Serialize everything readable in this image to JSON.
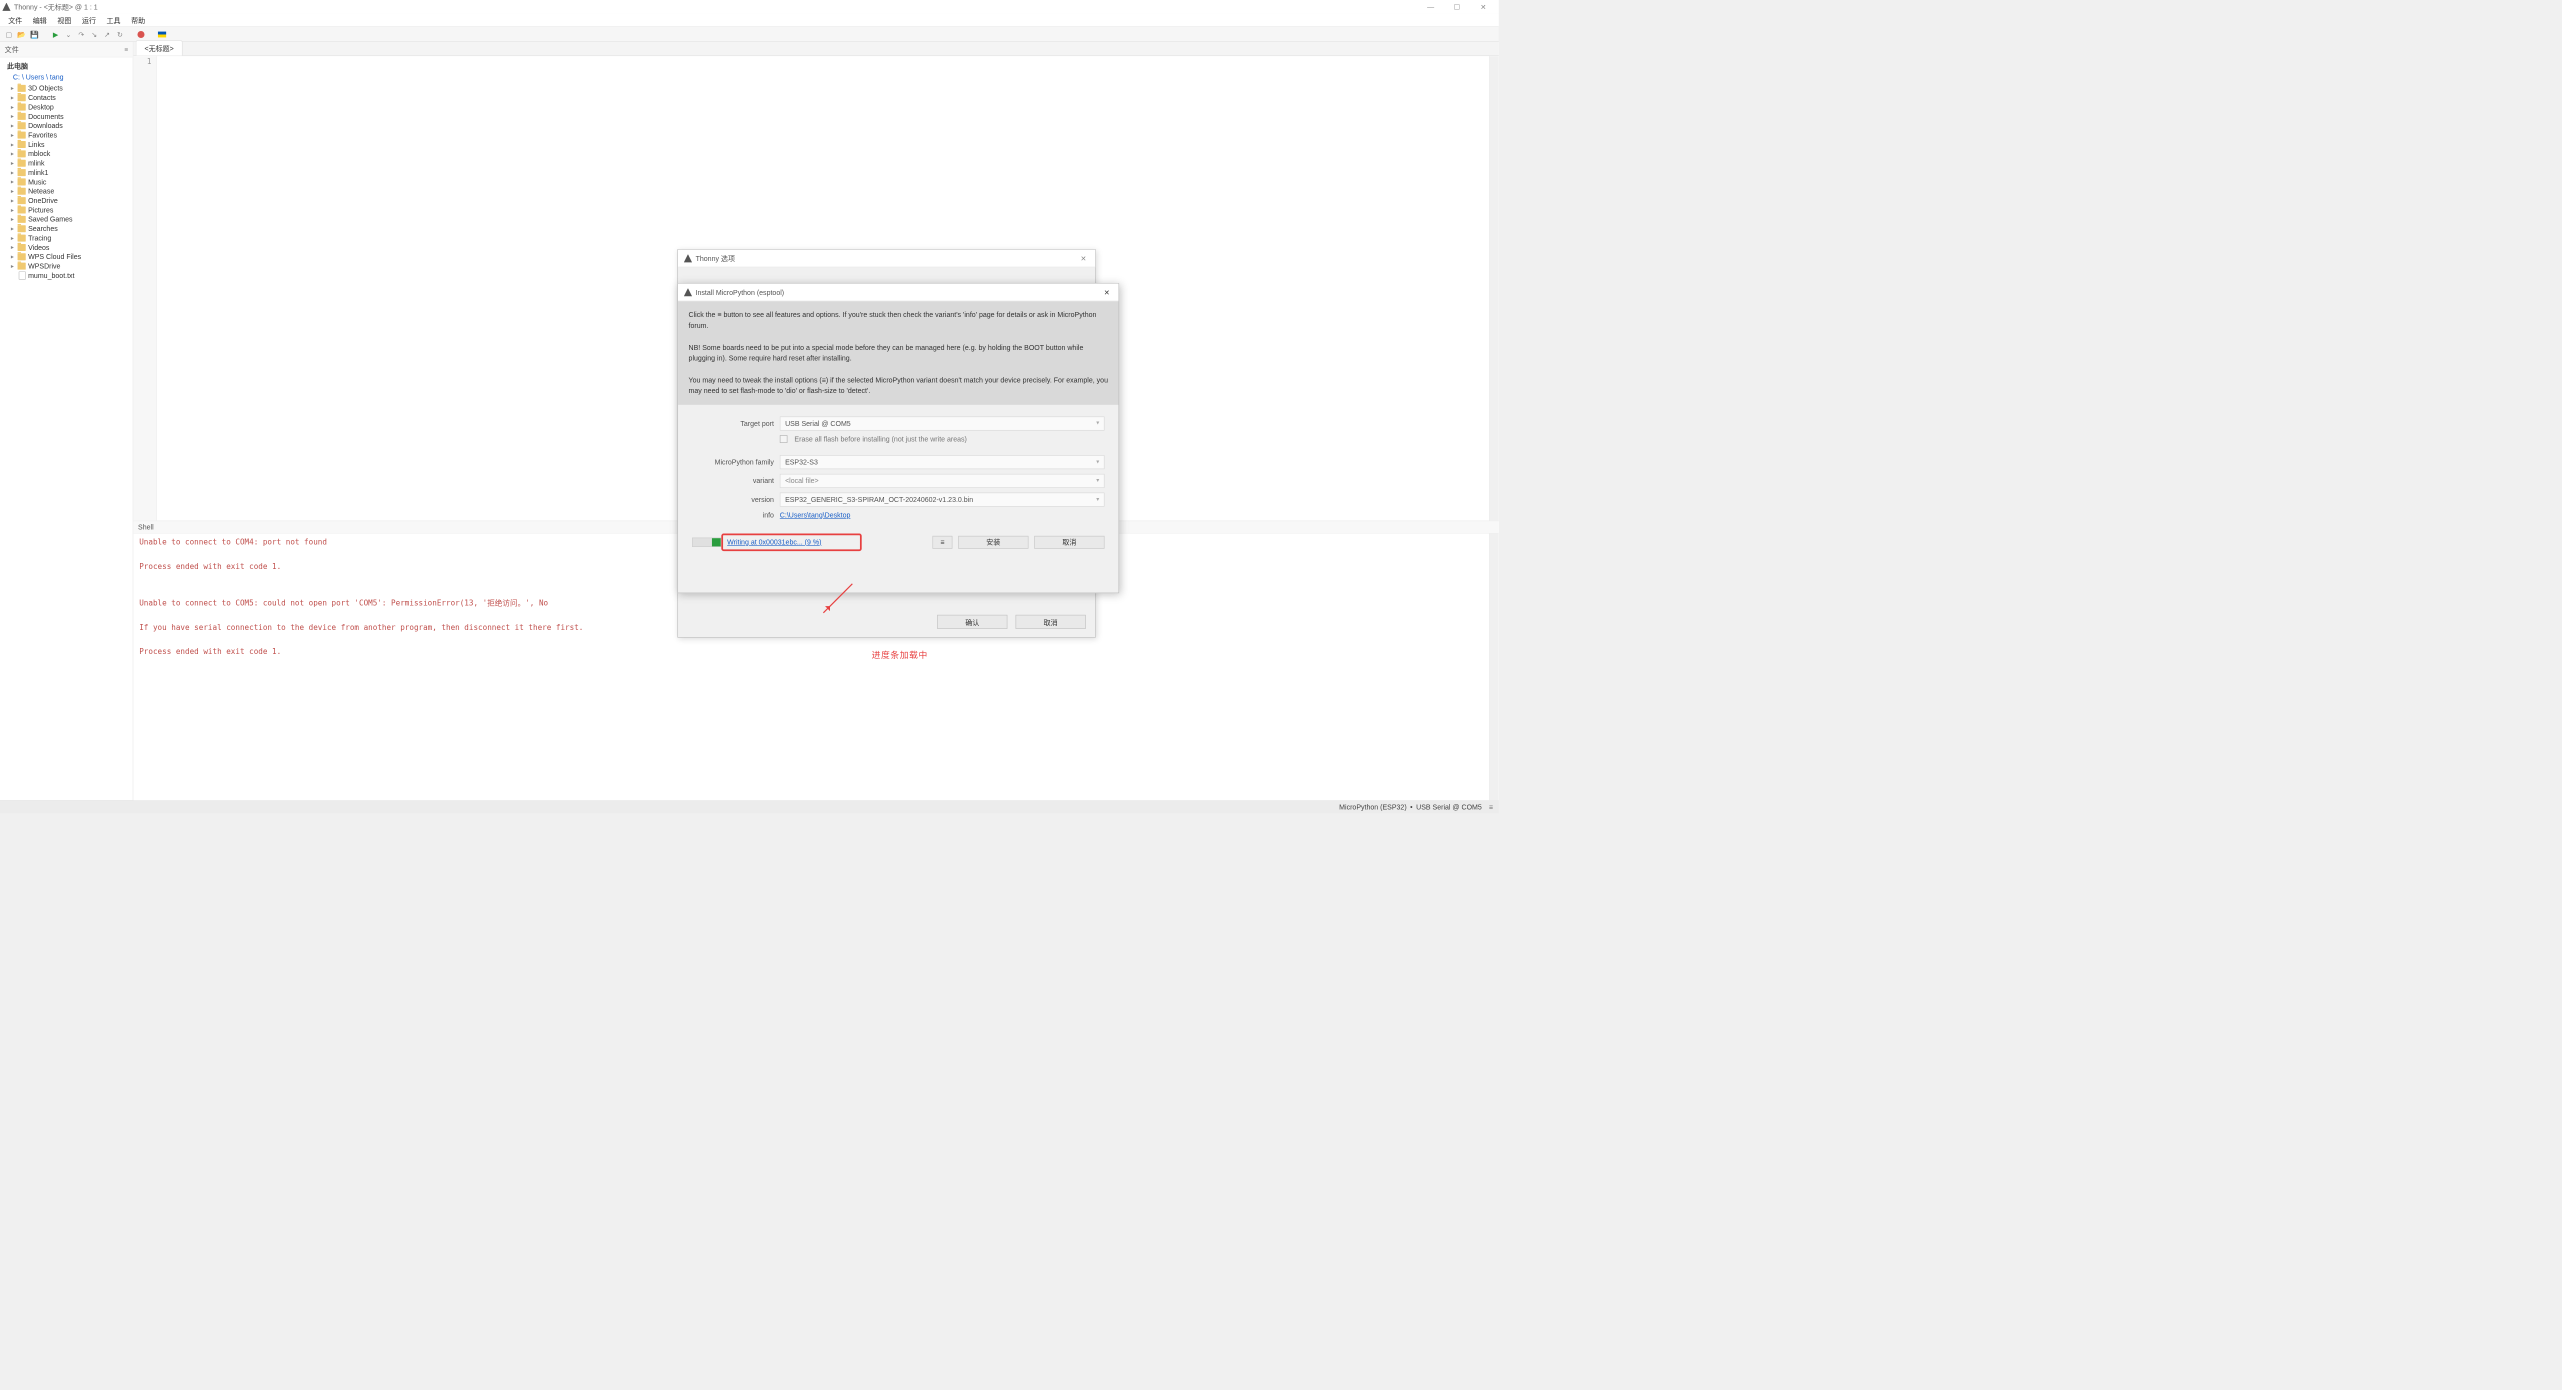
{
  "window": {
    "title": "Thonny  -  <无标题>  @  1 : 1",
    "win_min": "—",
    "win_max": "☐",
    "win_close": "✕"
  },
  "menu": {
    "items": [
      "文件",
      "编辑",
      "视图",
      "运行",
      "工具",
      "帮助"
    ]
  },
  "sidebar": {
    "title": "文件",
    "pin": "≡",
    "root": "此电脑",
    "path": "C: \\ Users \\ tang",
    "folders": [
      "3D Objects",
      "Contacts",
      "Desktop",
      "Documents",
      "Downloads",
      "Favorites",
      "Links",
      "mblock",
      "mlink",
      "mlink1",
      "Music",
      "Netease",
      "OneDrive",
      "Pictures",
      "Saved Games",
      "Searches",
      "Tracing",
      "Videos",
      "WPS Cloud Files",
      "WPSDrive"
    ],
    "file": "mumu_boot.txt"
  },
  "editor": {
    "tab_label": "<无标题>",
    "line1": "1"
  },
  "shell": {
    "title": "Shell",
    "lines": [
      "Unable to connect to COM4: port not found",
      "",
      "Process ended with exit code 1.",
      "",
      "",
      "Unable to connect to COM5: could not open port 'COM5': PermissionError(13, '拒绝访问。', No",
      "",
      "If you have serial connection to the device from another program, then disconnect it there first.",
      "",
      "Process ended with exit code 1."
    ]
  },
  "status": {
    "interpreter": "MicroPython (ESP32)",
    "sep": " • ",
    "port": "USB Serial @ COM5",
    "menu_glyph": "≡"
  },
  "options_dialog": {
    "title": "Thonny 选项",
    "ok": "确认",
    "cancel": "取消",
    "close_glyph": "✕"
  },
  "install_dialog": {
    "title": "Install MicroPython (esptool)",
    "close_glyph": "✕",
    "info_p1": "Click the ≡ button to see all features and options. If you're stuck then check the variant's 'info' page for details or ask in MicroPython forum.",
    "info_p2": "NB! Some boards need to be put into a special mode before they can be managed here (e.g. by holding the BOOT button while plugging in). Some require hard reset after installing.",
    "info_p3": "You may need to tweak the install options (≡) if the selected MicroPython variant doesn't match your device precisely. For example, you may need to set flash-mode to 'dio' or flash-size to 'detect'.",
    "labels": {
      "target_port": "Target port",
      "erase": "Erase all flash before installing (not just the write areas)",
      "family": "MicroPython family",
      "variant": "variant",
      "version": "version",
      "info": "info"
    },
    "values": {
      "target_port": "USB Serial @ COM5",
      "family": "ESP32-S3",
      "variant": "<local file>",
      "version": "ESP32_GENERIC_S3-SPIRAM_OCT-20240602-v1.23.0.bin",
      "info": "C:\\Users\\tang\\Desktop"
    },
    "progress_text": "Writing at 0x00031ebc... (9 %)",
    "hamb": "≡",
    "install": "安装",
    "cancel": "取消"
  },
  "annotation": {
    "text": "进度条加载中"
  }
}
